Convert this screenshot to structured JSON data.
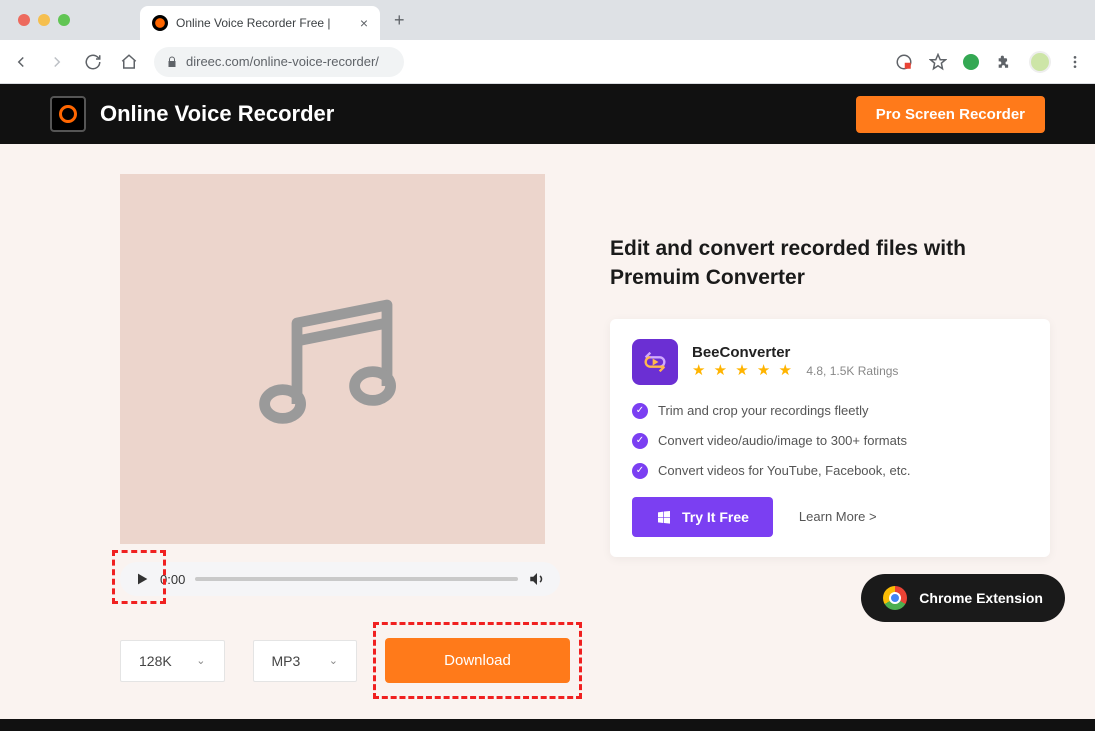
{
  "browser": {
    "tab_title": "Online Voice Recorder Free |",
    "url": "direec.com/online-voice-recorder/"
  },
  "header": {
    "title": "Online Voice Recorder",
    "pro_button": "Pro Screen Recorder"
  },
  "player": {
    "time": "0:00"
  },
  "controls": {
    "bitrate": "128K",
    "format": "MP3",
    "download": "Download"
  },
  "promo": {
    "heading": "Edit and convert recorded files with Premuim Converter",
    "app_name": "BeeConverter",
    "rating_text": "4.8, 1.5K Ratings",
    "features": [
      "Trim and crop your recordings fleetly",
      "Convert video/audio/image to 300+ formats",
      "Convert videos for YouTube, Facebook, etc."
    ],
    "try_button": "Try It Free",
    "learn_more": "Learn More >"
  },
  "extension": {
    "label": "Chrome Extension"
  }
}
